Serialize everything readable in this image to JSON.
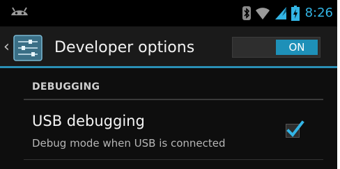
{
  "status_bar": {
    "time": "8:26",
    "icons": [
      "android-icon",
      "bluetooth-icon",
      "wifi-icon",
      "signal-icon",
      "battery-charging-icon"
    ],
    "accent_color": "#33b5e5"
  },
  "action_bar": {
    "up_glyph": "‹",
    "title": "Developer options",
    "app_icon": "developer-settings-icon",
    "toggle": {
      "label": "ON",
      "state": true,
      "color": "#1e90b8"
    }
  },
  "section": {
    "header": "DEBUGGING",
    "items": [
      {
        "title": "USB debugging",
        "summary": "Debug mode when USB is connected",
        "checked": true
      }
    ]
  }
}
